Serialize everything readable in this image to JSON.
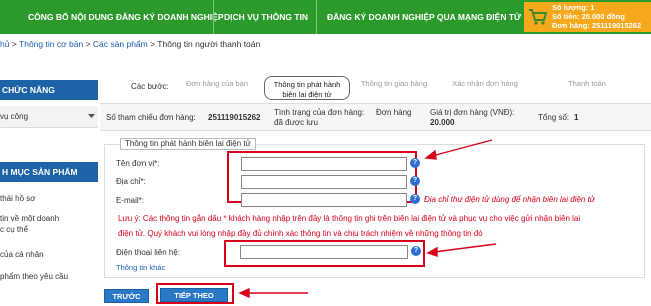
{
  "nav": {
    "items": [
      "CÔNG BỐ NỘI DUNG ĐĂNG KÝ DOANH NGHIỆP",
      "DỊCH VỤ THÔNG TIN",
      "ĐĂNG KÝ DOANH NGHIỆP QUA MẠNG ĐIỆN TỬ"
    ]
  },
  "cart": {
    "quantity": "Số lượng: 1",
    "total": "Số tiền: 20.000 đồng",
    "order": "Đơn hàng: 251119015262"
  },
  "breadcrumb": {
    "items": [
      "hủ",
      "Thông tin cơ bản",
      "Các sản phẩm",
      "Thông tin người thanh toán"
    ],
    "separator": ">"
  },
  "sidebar": {
    "functions_title": "CHỨC NĂNG",
    "functions_item": "vụ công",
    "products_title": "H MỤC SẢN PHẨM",
    "product_items": [
      "thái hồ sơ",
      "tin về một doanh",
      "c cụ thể",
      "của cá nhân",
      "phẩm theo yêu cầu"
    ]
  },
  "steps": {
    "label": "Các bước:",
    "items": [
      {
        "line1": "Đơn hàng của bạn",
        "line2": ""
      },
      {
        "line1": "Thông tin phát hành",
        "line2": "biên lai điện tử"
      },
      {
        "line1": "Thông tin giao hàng",
        "line2": ""
      },
      {
        "line1": "Xác nhận đơn hàng",
        "line2": ""
      },
      {
        "line1": "Thanh toán",
        "line2": ""
      }
    ]
  },
  "summary": {
    "ref_label": "Số tham chiếu đơn hàng:",
    "ref_value": "251119015262",
    "status_label": "Tình trạng của đơn hàng:",
    "status_value": "Đơn hàng",
    "status_value2": "đã được lưu",
    "amount_label": "Giá trị đơn hàng (VNĐ):",
    "amount_value": "20.000",
    "count_label": "Tổng số:",
    "count_value": "1"
  },
  "form": {
    "legend": "Thông tin phát hành biên lai điện tử",
    "unit_label": "Tên đơn vị*:",
    "address_label": "Địa chỉ*:",
    "email_label": "E-mail*:",
    "email_hint": "Địa chỉ thư điện tử dùng để nhận biên lai điện tử",
    "note_line1": "Lưu ý: Các thông tin gắn dấu * khách hàng nhập trên đây là thông tin ghi trên biên lai điện tử và phục vụ cho việc gửi nhận biên lai",
    "note_line2": "điện tử. Quý khách vui lòng nhập đầy đủ chính xác thông tin và chịu trách nhiệm về những thông tin đó",
    "phone_label": "Điện thoại liên hệ:",
    "other_info_link": "Thông tin khác",
    "unit_value": "",
    "address_value": "",
    "email_value": "",
    "phone_value": "",
    "help_glyph": "?"
  },
  "buttons": {
    "back": "TRƯỚC",
    "next": "TIẾP THEO"
  },
  "colors": {
    "nav_green": "#2b9a2a",
    "cart_orange": "#f5a81c",
    "sidebar_blue": "#1d63a8",
    "button_blue": "#2b78c7",
    "highlight_red": "#d9001b",
    "link_blue": "#1a5fb4"
  }
}
